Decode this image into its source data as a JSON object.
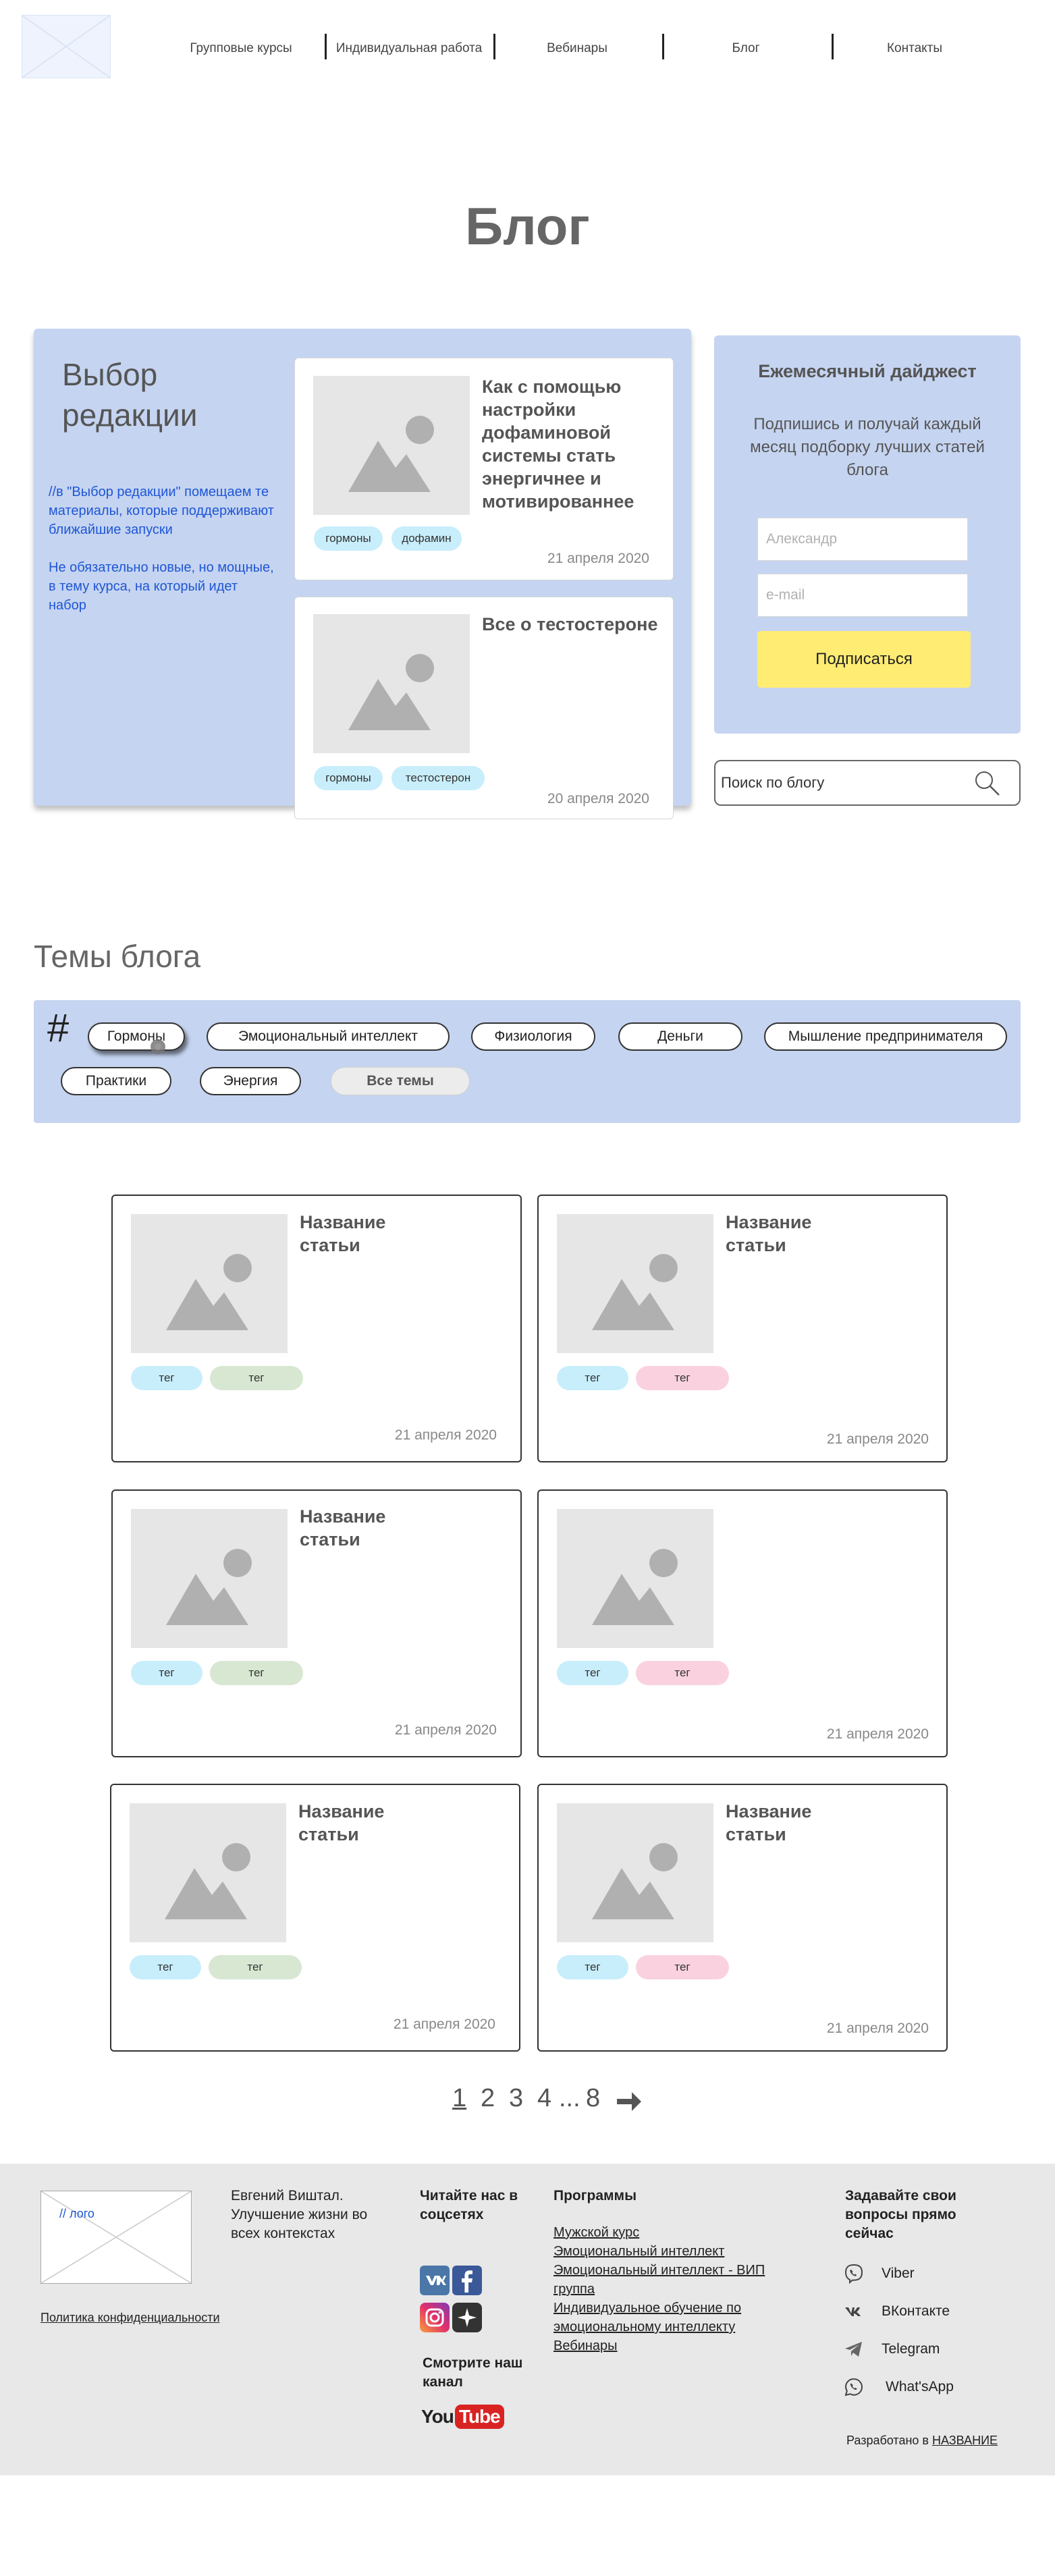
{
  "header": {
    "nav": [
      "Групповые курсы",
      "Индивидуальная работа",
      "Вебинары",
      "Блог",
      "Контакты"
    ]
  },
  "page_title": "Блог",
  "editor": {
    "heading": "Выбор редакции",
    "note_1": "//в \"Выбор редакции\" помещаем те материалы, которые поддерживают ближайшие запуски",
    "note_2": "Не обязательно новые, но мощные, в тему курса, на который идет набор",
    "articles": [
      {
        "title": "Как с помощью настройки дофаминовой системы стать энергичнее и мотивированнее",
        "tags": [
          "гормоны",
          "дофамин"
        ],
        "date": "21 апреля 2020"
      },
      {
        "title": "Все о тестостероне",
        "tags": [
          "гормоны",
          "тестостерон"
        ],
        "date": "20 апреля 2020"
      }
    ]
  },
  "digest": {
    "title": "Ежемесячный дайджест",
    "text": "Подпишись и получай каждый месяц подборку лучших статей блога",
    "name_placeholder": "Александр",
    "email_placeholder": "e-mail",
    "button": "Подписаться"
  },
  "search": {
    "placeholder": "Поиск по блогу"
  },
  "topics": {
    "title": "Темы блога",
    "symbol": "#",
    "items": [
      "Гормоны",
      "Эмоциональный интеллект",
      "Физиология",
      "Деньги",
      "Мышление предпринимателя",
      "Практики",
      "Энергия"
    ],
    "all": "Все темы"
  },
  "articles": [
    {
      "title": "Название статьи",
      "tags": [
        "тег",
        "тег"
      ],
      "date": "21 апреля 2020"
    },
    {
      "title": "Название статьи",
      "tags": [
        "тег",
        "тег"
      ],
      "date": "21 апреля 2020"
    },
    {
      "title": "Название статьи",
      "tags": [
        "тег",
        "тег"
      ],
      "date": "21 апреля 2020"
    },
    {
      "title": "Название статьи",
      "tags": [
        "тег",
        "тег"
      ],
      "date": "21 апреля 2020"
    },
    {
      "title": "Название статьи",
      "tags": [
        "тег",
        "тег"
      ],
      "date": "21 апреля 2020"
    },
    {
      "title": "Название статьи",
      "tags": [
        "тег",
        "тег"
      ],
      "date": "21 апреля 2020"
    }
  ],
  "pagination": {
    "pages": [
      "1",
      "2",
      "3",
      "4"
    ],
    "ellipsis": "...",
    "last": "8",
    "current": "1"
  },
  "footer": {
    "logo_label": "// лого",
    "about": "Евгений Виштал. Улучшение жизни во всех контекстах",
    "privacy": "Политика конфиденциальности",
    "social_heading": "Читайте нас в соцсетях",
    "channel_heading": "Смотрите наш канал",
    "youtube_label": [
      "You",
      "Tube"
    ],
    "programs_heading": "Программы",
    "programs": [
      "Мужской курс",
      "Эмоциональный интеллект",
      "Эмоциональный интеллект - ВИП группа",
      "Индивидуальное обучение по эмоциональному интеллекту",
      "Вебинары"
    ],
    "contact_heading": "Задавайте свои вопросы прямо сейчас",
    "contacts": [
      "Viber",
      "ВКонтакте",
      "Telegram",
      "What'sApp"
    ],
    "dev_prefix": "Разработано в",
    "dev_link": "НАЗВАНИЕ"
  },
  "colors": {
    "panel": "#c5d4f0",
    "accent_yellow": "#ffec73",
    "tag_blue": "#c8eefb",
    "tag_green": "#d8e7d2",
    "tag_pink": "#fad2df",
    "note_blue": "#1e56d6",
    "footer_bg": "#e8e8e8"
  }
}
